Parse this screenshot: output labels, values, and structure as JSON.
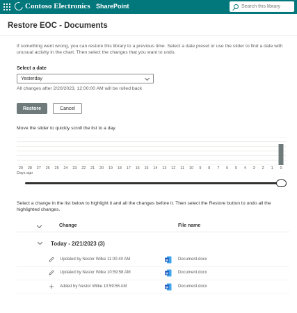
{
  "suite": {
    "brand": "Contoso Electronics",
    "app": "SharePoint",
    "search_placeholder": "Search this library"
  },
  "page": {
    "title": "Restore EOC - Documents",
    "intro": "If something went wrong, you can restore this library to a previous time. Select a date preset or use the slider to find a date with unusual activity in the chart. Then select the changes that you want to undo."
  },
  "date_picker": {
    "label": "Select a date",
    "selected": "Yesterday",
    "note": "All changes after 2/20/2023, 12:00:00 AM will be rolled back"
  },
  "actions": {
    "restore_label": "Restore",
    "cancel_label": "Cancel"
  },
  "slider": {
    "hint": "Move the slider to quickly scroll the list to a day.",
    "axis_label": "Days ago",
    "value_days_ago": 0
  },
  "chart_data": {
    "type": "bar",
    "categories": [
      "29",
      "28",
      "27",
      "26",
      "25",
      "24",
      "23",
      "22",
      "21",
      "20",
      "19",
      "18",
      "17",
      "16",
      "15",
      "14",
      "13",
      "12",
      "11",
      "10",
      "9",
      "8",
      "7",
      "6",
      "5",
      "4",
      "3",
      "2",
      "1",
      "0"
    ],
    "values": [
      0,
      0,
      0,
      0,
      0,
      0,
      0,
      0,
      0,
      0,
      0,
      0,
      0,
      0,
      0,
      0,
      0,
      0,
      0,
      0,
      0,
      0,
      0,
      0,
      0,
      0,
      0,
      0,
      0,
      3
    ],
    "xlabel": "Days ago",
    "ylim": [
      0,
      3
    ],
    "grid": true,
    "bar_color": "#6f7b7b"
  },
  "list": {
    "hint": "Select a change in the list below to highlight it and all the changes before it. Then select the Restore button to undo all the highlighted changes.",
    "col_change": "Change",
    "col_file": "File name",
    "group_title": "Today - 2/21/2023 (3)",
    "rows": [
      {
        "icon": "pencil-icon",
        "description": "Updated by Nestor Wilke 11:00:40 AM",
        "file": "Document.docx"
      },
      {
        "icon": "pencil-icon",
        "description": "Updated by Nestor Wilke 10:59:58 AM",
        "file": "Document.docx"
      },
      {
        "icon": "plus-icon",
        "description": "Added by Nestor Wilke 10:59:56 AM",
        "file": "Document.docx"
      }
    ]
  },
  "colors": {
    "suite_bar": "#03787c",
    "primary_button": "#6f7b7b",
    "word_blue": "#185abd"
  }
}
